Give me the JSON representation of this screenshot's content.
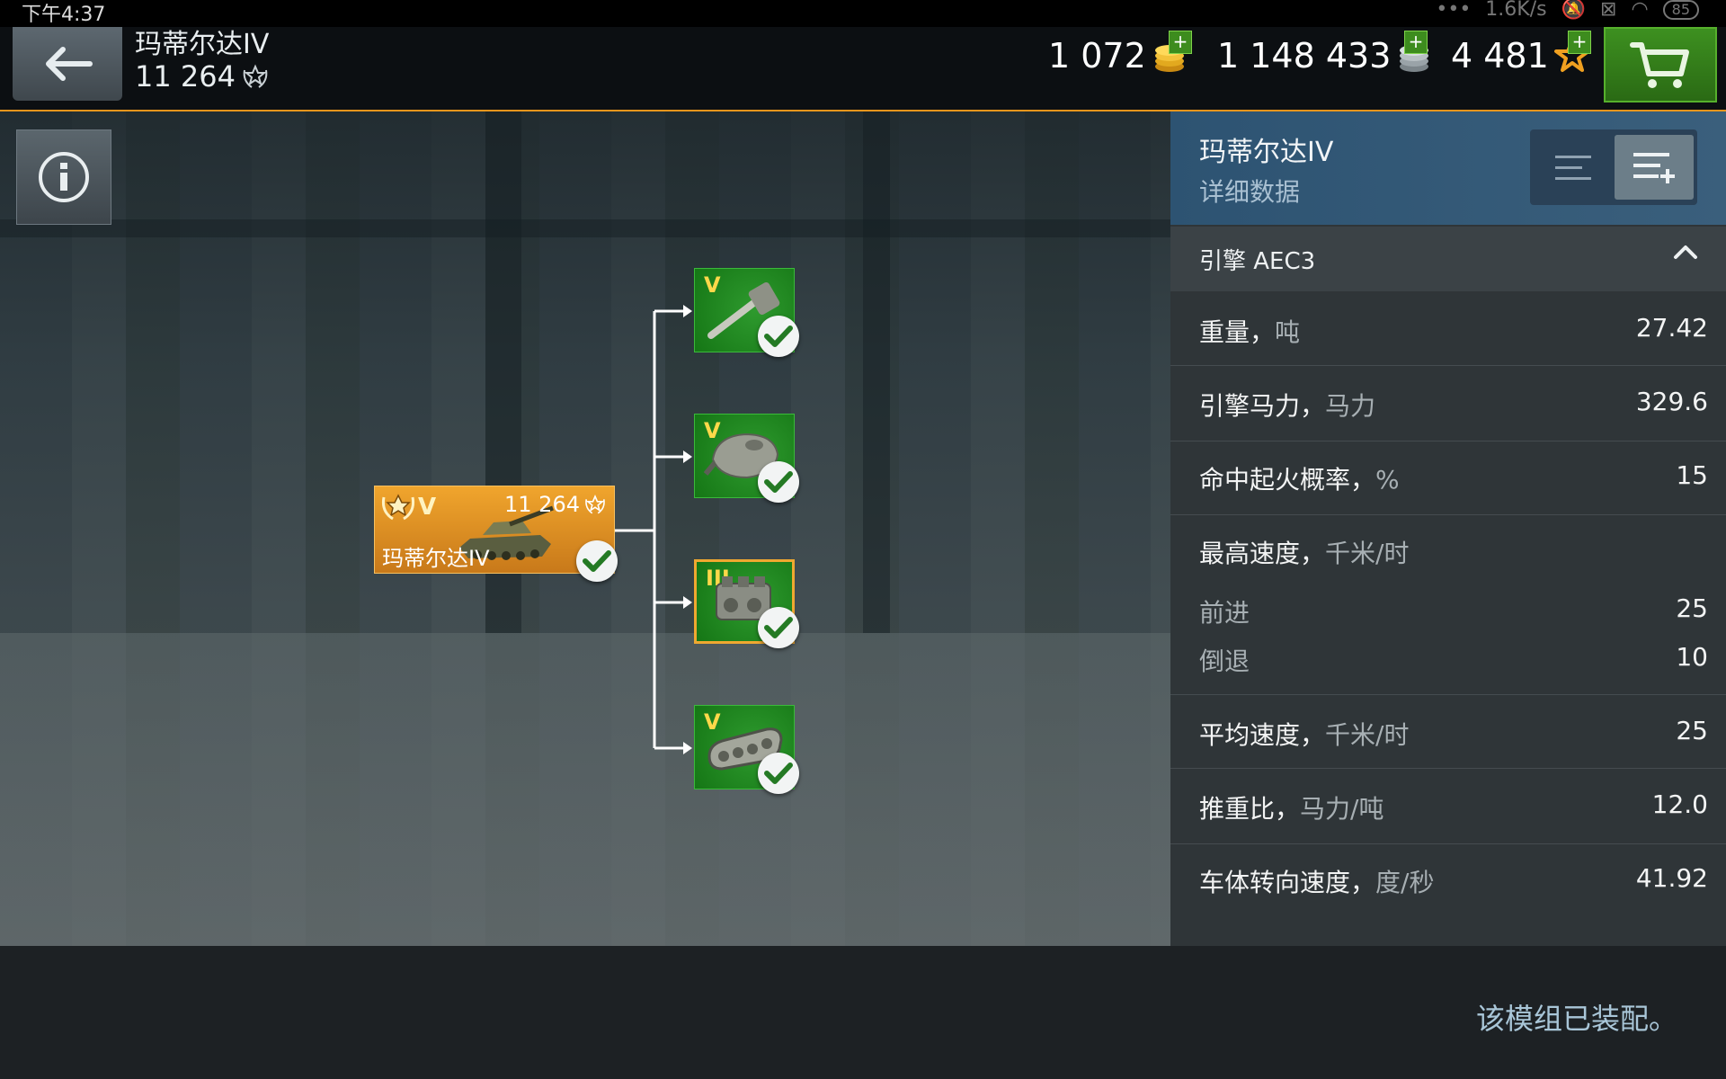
{
  "status_bar": {
    "time": "下午4:37",
    "net_speed": "1.6K/s",
    "battery": "85"
  },
  "header": {
    "tank_name": "玛蒂尔达IV",
    "tank_xp": "11 264",
    "currencies": {
      "gold": "1 072",
      "silver": "1 148 433",
      "free_xp": "4 481"
    },
    "plus_symbol": "+"
  },
  "tank_node": {
    "tier": "V",
    "xp": "11 264",
    "name": "玛蒂尔达IV"
  },
  "modules": [
    {
      "tier": "V",
      "icon": "gun-icon",
      "equipped": true,
      "selected": false
    },
    {
      "tier": "V",
      "icon": "turret-icon",
      "equipped": true,
      "selected": false
    },
    {
      "tier": "III",
      "icon": "engine-icon",
      "equipped": true,
      "selected": true
    },
    {
      "tier": "V",
      "icon": "tracks-icon",
      "equipped": true,
      "selected": false
    }
  ],
  "panel": {
    "title": "玛蒂尔达IV",
    "subtitle": "详细数据",
    "section_label": "引擎 AEC3",
    "stats": [
      {
        "label": "重量，",
        "unit": "吨",
        "value": "27.42"
      },
      {
        "label": "引擎马力，",
        "unit": "马力",
        "value": "329.6"
      },
      {
        "label": "命中起火概率，",
        "unit": "%",
        "value": "15"
      },
      {
        "label": "最高速度，",
        "unit": "千米/时",
        "value": ""
      },
      {
        "label": "前进",
        "unit": "",
        "value": "25"
      },
      {
        "label": "倒退",
        "unit": "",
        "value": "10"
      },
      {
        "label": "平均速度，",
        "unit": "千米/时",
        "value": "25"
      },
      {
        "label": "推重比，",
        "unit": "马力/吨",
        "value": "12.0"
      },
      {
        "label": "车体转向速度，",
        "unit": "度/秒",
        "value": "41.92"
      }
    ]
  },
  "footer": {
    "message": "该模组已装配。"
  },
  "colors": {
    "accent_orange": "#e8951c",
    "module_green": "#1f8a1f",
    "panel_blue": "#2d5372"
  }
}
